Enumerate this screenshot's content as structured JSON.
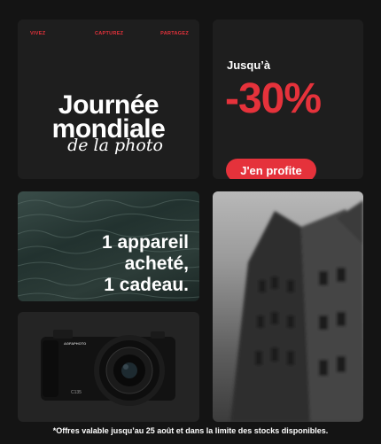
{
  "colors": {
    "accent": "#e5323b",
    "card": "#1e1e1e",
    "background": "#141414",
    "text": "#ffffff"
  },
  "taglines": [
    "VIVEZ",
    "CAPTUREZ",
    "PARTAGEZ"
  ],
  "hero": {
    "line1": "Journée",
    "line2": "mondiale",
    "line3": "de la photo"
  },
  "offer": {
    "upto": "Jusqu’à",
    "discount": "-30%",
    "cta": "J'en profite"
  },
  "promo": {
    "line1": "1 appareil",
    "line2": "acheté,",
    "line3": "1 cadeau."
  },
  "camera": {
    "brand": "AGFAPHOTO",
    "model": "C135"
  },
  "footnote": "*Offres valable jusqu’au 25 août et dans la limite des stocks disponibles."
}
